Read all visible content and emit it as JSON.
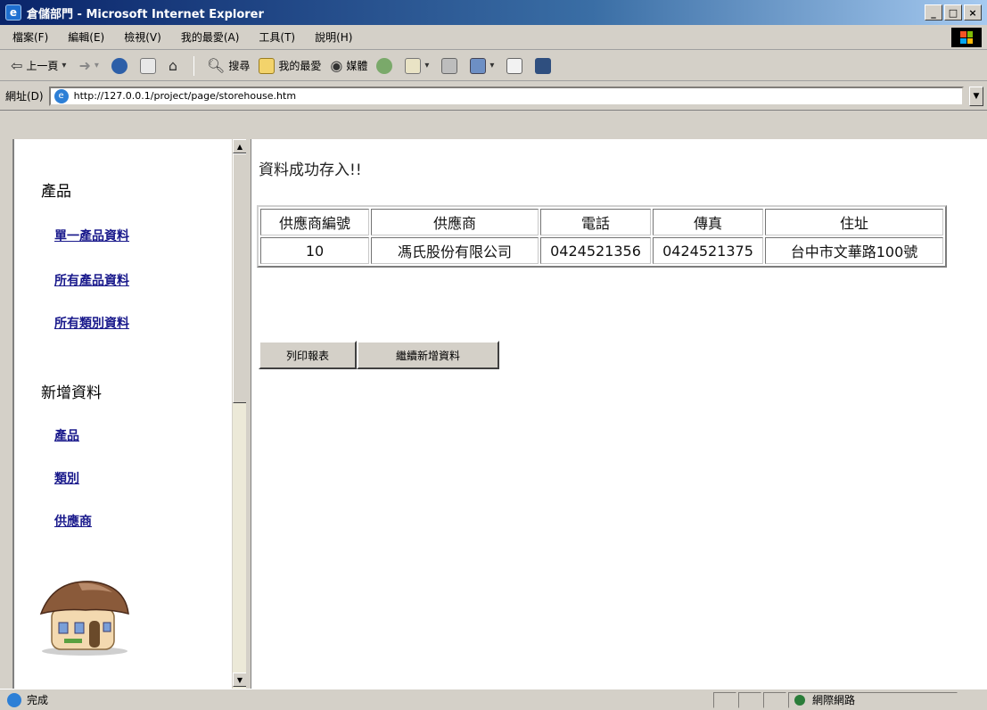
{
  "window": {
    "title": "倉儲部門 - Microsoft Internet Explorer",
    "controls": [
      "_",
      "□",
      "×"
    ]
  },
  "menu": [
    "檔案(F)",
    "編輯(E)",
    "檢視(V)",
    "我的最愛(A)",
    "工具(T)",
    "說明(H)"
  ],
  "toolbar": {
    "back_label": "上一頁",
    "search_label": "搜尋",
    "favorites_label": "我的最愛",
    "media_label": "媒體"
  },
  "address": {
    "label": "網址(D)",
    "url": "http://127.0.0.1/project/page/storehouse.htm"
  },
  "sidebar": {
    "section1_title": "產品",
    "links1": [
      "單一產品資料",
      "所有產品資料",
      "所有類別資料"
    ],
    "section2_title": "新增資料",
    "links2": [
      "產品",
      "類別",
      "供應商"
    ]
  },
  "main": {
    "message": "資料成功存入!!",
    "table": {
      "headers": [
        "供應商編號",
        "供應商",
        "電話",
        "傳真",
        "住址"
      ],
      "row": [
        "10",
        "馮氏股份有限公司",
        "0424521356",
        "0424521375",
        "台中市文華路100號"
      ]
    },
    "buttons": {
      "print": "列印報表",
      "continue": "繼續新增資料"
    }
  },
  "status": {
    "text": "完成",
    "zone": "網際網路"
  }
}
